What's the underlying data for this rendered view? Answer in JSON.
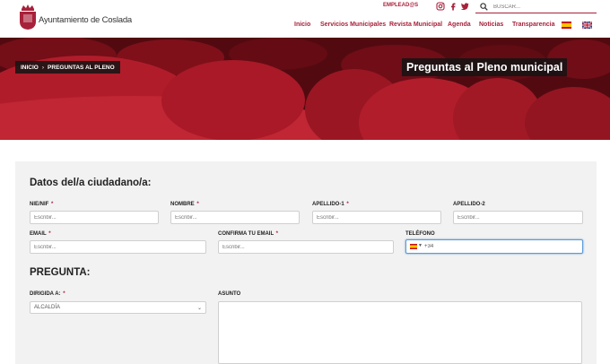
{
  "header": {
    "logo_text": "Ayuntamiento de Coslada",
    "employee_link": "EMPLEAD@S",
    "search": {
      "placeholder": "BUSCAR..."
    },
    "icons": [
      "instagram-icon",
      "facebook-icon",
      "twitter-icon",
      "search-icon"
    ],
    "nav": [
      {
        "label": "Inicio"
      },
      {
        "label": "Servicios Municipales"
      },
      {
        "label": "Revista Municipal"
      },
      {
        "label": "Agenda"
      },
      {
        "label": "Noticias"
      },
      {
        "label": "Transparencia"
      }
    ],
    "languages": [
      "es-flag",
      "uk-flag"
    ]
  },
  "hero": {
    "breadcrumb": {
      "home": "INICIO",
      "current": "PREGUNTAS AL PLENO"
    },
    "title": "Preguntas al Pleno municipal"
  },
  "form": {
    "citizen_title": "Datos del/a ciudadano/a:",
    "nie": {
      "label": "NIE/NIF",
      "required": "*",
      "placeholder": "Escribir..."
    },
    "nombre": {
      "label": "NOMBRE",
      "required": "*",
      "placeholder": "Escribir..."
    },
    "apellido1": {
      "label": "APELLIDO-1",
      "required": "*",
      "placeholder": "Escribir..."
    },
    "apellido2": {
      "label": "APELLIDO-2",
      "placeholder": "Escribir..."
    },
    "email": {
      "label": "EMAIL",
      "required": "*",
      "placeholder": "Escribir..."
    },
    "confirm_email": {
      "label": "CONFIRMA TU EMAIL",
      "required": "*",
      "placeholder": "Escribir..."
    },
    "telefono": {
      "label": "TELÉFONO",
      "value": "+34"
    },
    "question_title": "PREGUNTA:",
    "dirigida": {
      "label": "DIRIGIDA A:",
      "required": "*",
      "selected": "ALCALDÍA"
    },
    "asunto": {
      "label": "ASUNTO"
    }
  },
  "colors": {
    "brand": "#a8213a",
    "focus": "#5b9bd5",
    "card": "#f2f2f2"
  }
}
